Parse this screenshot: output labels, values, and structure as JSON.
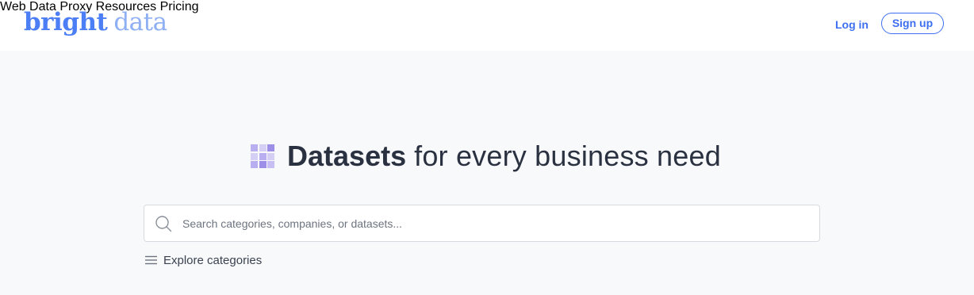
{
  "brand": {
    "word1": "bright",
    "word2": "data",
    "primary_color": "#4c7ef5",
    "secondary_color": "#8eaff4"
  },
  "nav": {
    "items": [
      {
        "label": "Web Data"
      },
      {
        "label": "Proxy"
      },
      {
        "label": "Resources"
      },
      {
        "label": "Pricing"
      }
    ],
    "login_label": "Log in",
    "signup_label": "Sign up"
  },
  "hero": {
    "title_strong": "Datasets",
    "title_rest": "for every business need",
    "icon": "dataset-grid-icon"
  },
  "search": {
    "placeholder": "Search categories, companies, or datasets...",
    "value": "",
    "icon": "search-icon"
  },
  "explore": {
    "label": "Explore categories",
    "icon": "hamburger-menu-icon"
  }
}
